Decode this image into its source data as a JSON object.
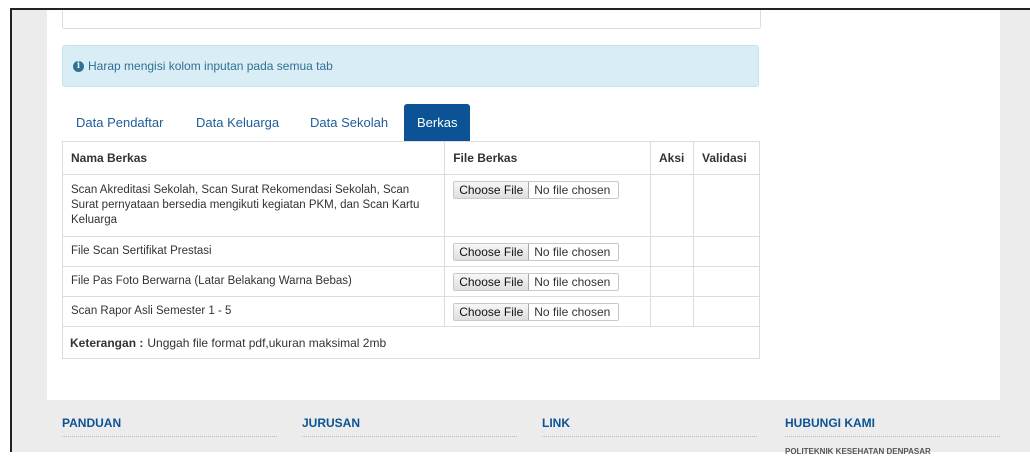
{
  "alert": {
    "icon": "info-icon",
    "text": "Harap mengisi kolom inputan pada semua tab"
  },
  "tabs": [
    {
      "label": "Data Pendaftar",
      "active": false
    },
    {
      "label": "Data Keluarga",
      "active": false
    },
    {
      "label": "Data Sekolah",
      "active": false
    },
    {
      "label": "Berkas",
      "active": true
    }
  ],
  "table": {
    "headers": [
      "Nama Berkas",
      "File Berkas",
      "Aksi",
      "Validasi"
    ],
    "rows": [
      {
        "name": "Scan Akreditasi Sekolah, Scan Surat Rekomendasi Sekolah, Scan Surat pernyataan bersedia mengikuti kegiatan PKM, dan Scan Kartu Keluarga",
        "button": "Choose File",
        "status": "No file chosen"
      },
      {
        "name": "File Scan Sertifikat Prestasi",
        "button": "Choose File",
        "status": "No file chosen"
      },
      {
        "name": "File Pas Foto Berwarna (Latar Belakang Warna Bebas)",
        "button": "Choose File",
        "status": "No file chosen"
      },
      {
        "name": "Scan Rapor Asli Semester 1 - 5",
        "button": "Choose File",
        "status": "No file chosen"
      }
    ]
  },
  "note": {
    "label": "Keterangan :",
    "text": "Unggah file format pdf,ukuran maksimal 2mb"
  },
  "footer": {
    "columns": [
      {
        "heading": "PANDUAN"
      },
      {
        "heading": "JURUSAN"
      },
      {
        "heading": "LINK"
      },
      {
        "heading": "HUBUNGI KAMI",
        "sub": "POLITEKNIK KESEHATAN DENPASAR"
      }
    ]
  },
  "colors": {
    "accent": "#0b5394",
    "alert_bg": "#d9edf7",
    "alert_text": "#31708f"
  }
}
